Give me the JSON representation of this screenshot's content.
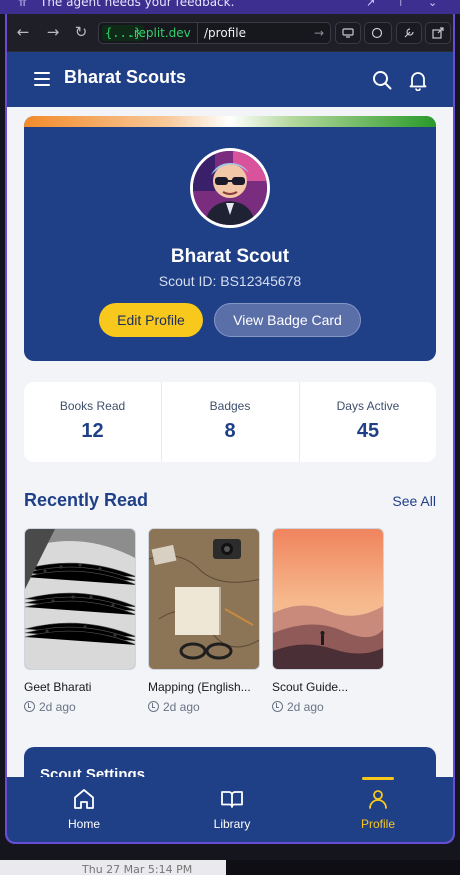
{
  "agent_banner": {
    "text": "The agent needs your feedback."
  },
  "browser": {
    "domain_chip": "{...}",
    "domain_rest": ".replit.dev",
    "path": "/profile"
  },
  "app": {
    "title": "Bharat Scouts",
    "profile": {
      "name": "Bharat Scout",
      "scout_id": "Scout ID: BS12345678",
      "edit_label": "Edit Profile",
      "badge_card_label": "View Badge Card"
    },
    "stats": [
      {
        "label": "Books Read",
        "value": "12"
      },
      {
        "label": "Badges",
        "value": "8"
      },
      {
        "label": "Days Active",
        "value": "45"
      }
    ],
    "recent": {
      "title": "Recently Read",
      "see_all": "See All",
      "books": [
        {
          "title": "Geet Bharati",
          "ago": "2d ago",
          "cover": "sheet-music"
        },
        {
          "title": "Mapping (English...",
          "ago": "2d ago",
          "cover": "map-and-notebook"
        },
        {
          "title": "Scout Guide...",
          "ago": "2d ago",
          "cover": "mountain-sunset"
        }
      ]
    },
    "settings": {
      "title": "Scout Settings"
    },
    "bottom_nav": [
      {
        "label": "Home",
        "icon": "home-icon",
        "active": false
      },
      {
        "label": "Library",
        "icon": "book-open-icon",
        "active": false
      },
      {
        "label": "Profile",
        "icon": "user-icon",
        "active": true
      }
    ]
  },
  "taskbar": {
    "text": "Thu 27 Mar 5:14 PM"
  },
  "colors": {
    "primary": "#1f3f87",
    "accent": "#f8c81c",
    "background": "#f2f4f8",
    "url_green": "#33d06c"
  }
}
